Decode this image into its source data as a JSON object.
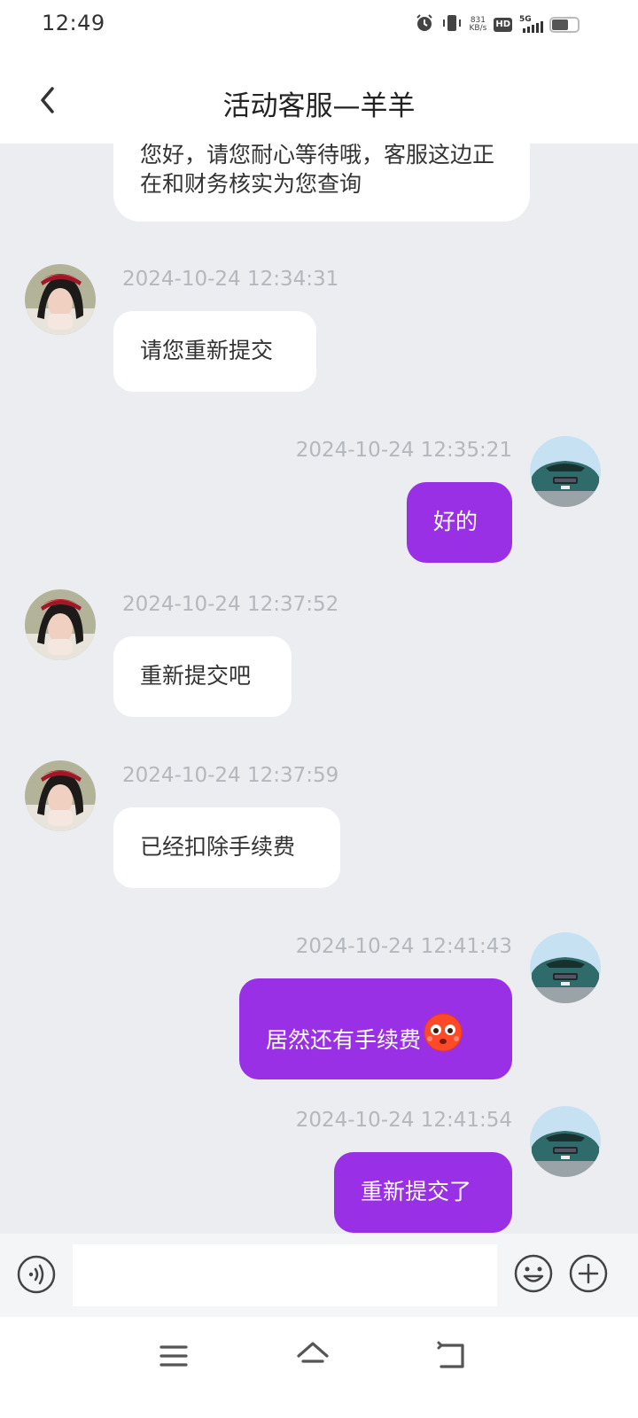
{
  "status_bar": {
    "time": "12:49",
    "net_speed_value": "831",
    "net_speed_unit": "KB/s",
    "hd_label": "HD",
    "network_label": "5G"
  },
  "header": {
    "title": "活动客服—羊羊"
  },
  "messages": [
    {
      "direction": "incoming",
      "text": "您好，请您耐心等待哦，客服这边正在和财务核实为您查询"
    },
    {
      "direction": "incoming",
      "timestamp": "2024-10-24 12:34:31",
      "text": "请您重新提交"
    },
    {
      "direction": "outgoing",
      "timestamp": "2024-10-24 12:35:21",
      "text": "好的"
    },
    {
      "direction": "incoming",
      "timestamp": "2024-10-24 12:37:52",
      "text": "重新提交吧"
    },
    {
      "direction": "incoming",
      "timestamp": "2024-10-24 12:37:59",
      "text": "已经扣除手续费"
    },
    {
      "direction": "outgoing",
      "timestamp": "2024-10-24 12:41:43",
      "text": "居然还有手续费",
      "emoji": "flushed-face-emoji"
    },
    {
      "direction": "outgoing",
      "timestamp": "2024-10-24 12:41:54",
      "text": "重新提交了"
    }
  ],
  "input": {
    "value": "",
    "placeholder": ""
  },
  "icons": {
    "back": "back-chevron-icon",
    "voice": "voice-icon",
    "emoji": "smiley-icon",
    "plus": "plus-icon",
    "nav_menu": "menu-icon",
    "nav_home": "home-icon",
    "nav_back": "return-icon"
  },
  "colors": {
    "outgoing_bubble": "#9a30e6",
    "incoming_bubble": "#ffffff",
    "chat_background": "#ebedf0",
    "timestamp_text": "#b4b7bc"
  }
}
